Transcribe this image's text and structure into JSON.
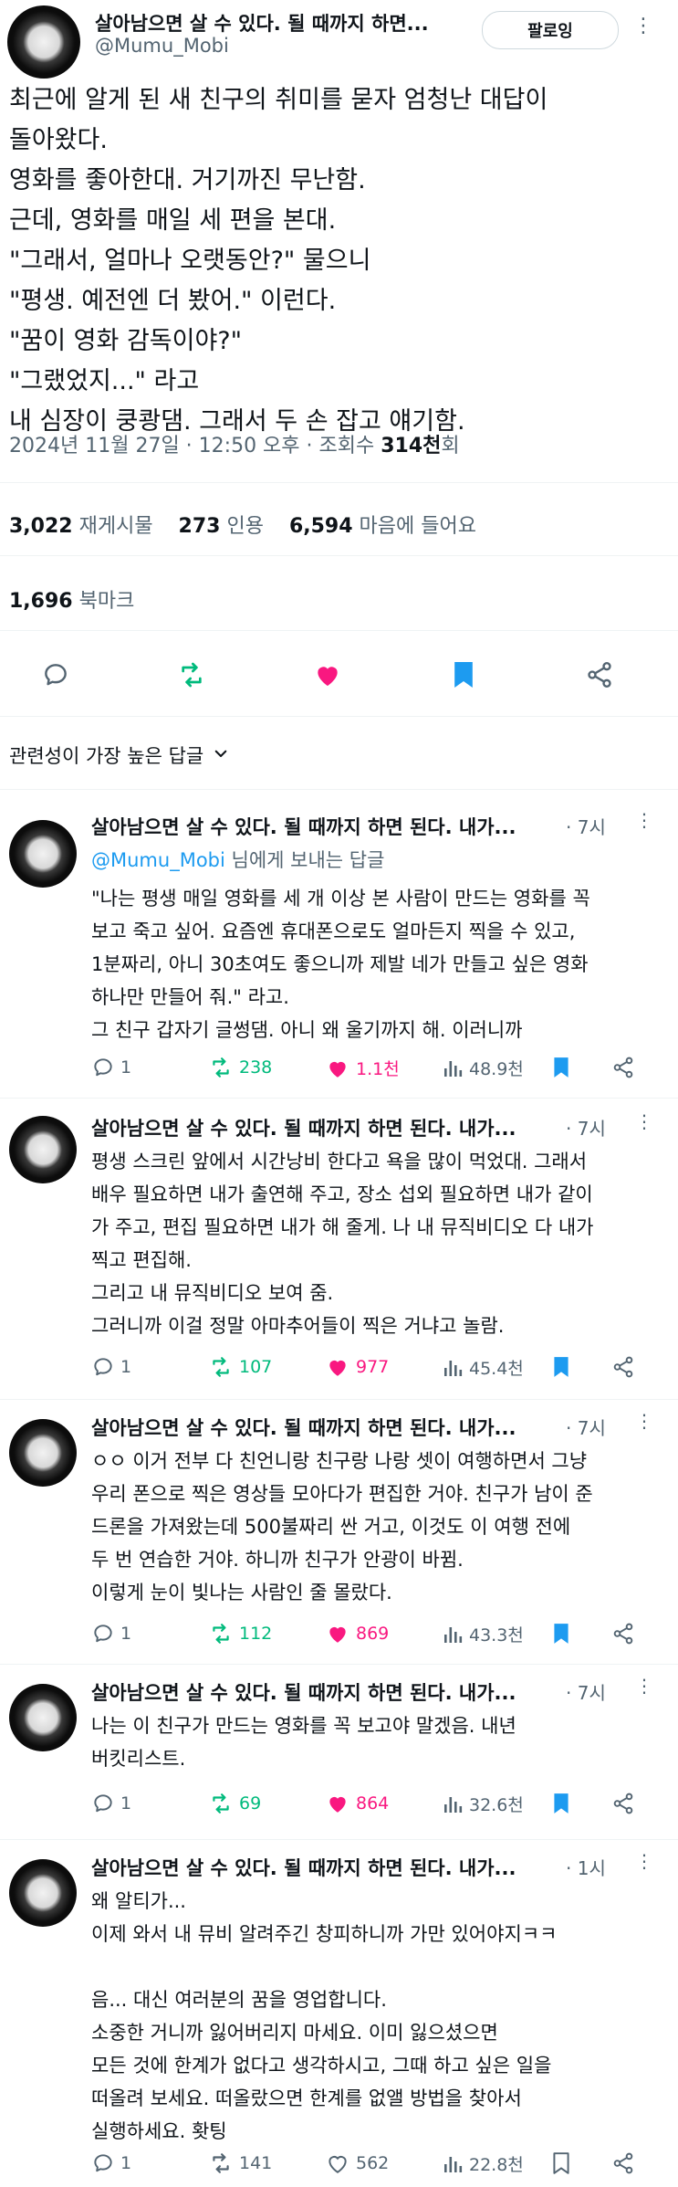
{
  "tweet": {
    "author_name": "살아남으면 살 수 있다. 될 때까지 하면...",
    "handle": "@Mumu_Mobi",
    "follow_label": "팔로잉",
    "lines": [
      "최근에 알게 된 새 친구의 취미를 묻자 엄청난 대답이",
      "돌아왔다.",
      "영화를 좋아한대. 거기까진 무난함.",
      "근데, 영화를 매일 세 편을 본대.",
      "\"그래서, 얼마나 오랫동안?\" 물으니",
      "\"평생. 예전엔 더 봤어.\" 이런다.",
      "\"꿈이 영화 감독이야?\"",
      "\"그랬었지...\" 라고",
      "내 심장이 쿵쾅댐. 그래서 두 손 잡고 얘기함."
    ],
    "date": "2024년 11월 27일 · 12:50 오후 · 조회수 ",
    "views": "314천",
    "views_suffix": "회",
    "retweets": "3,022",
    "retweets_label": "재게시물",
    "quotes": "273",
    "quotes_label": "인용",
    "likes": "6,594",
    "likes_label": "마음에 들어요",
    "bookmarks": "1,696",
    "bookmarks_label": "북마크"
  },
  "sort_label": "관련성이 가장 높은 답글",
  "colors": {
    "retweet": "#00ba7c",
    "like": "#f91880",
    "link": "#1d9bf0",
    "bookmark": "#1d9bf0"
  },
  "replies": [
    {
      "name": "살아남으면 살 수 있다. 될 때까지 하면 된다. 내가...",
      "time": "· 7시",
      "to_handle": "@Mumu_Mobi",
      "to_suffix": " 님에게 보내는 답글",
      "lines": [
        "\"나는 평생 매일 영화를 세 개 이상 본 사람이 만드는 영화를 꼭",
        "보고 죽고 싶어. 요즘엔 휴대폰으로도 얼마든지 찍을 수 있고,",
        "1분짜리, 아니 30초여도 좋으니까 제발 네가 만들고 싶은 영화",
        "하나만 만들어 줘.\" 라고.",
        "그 친구 갑자기 글썽댐. 아니 왜 울기까지 해. 이러니까"
      ],
      "replies": "1",
      "retweets": "238",
      "likes": "1.1천",
      "views": "48.9천",
      "liked": true,
      "bookmarked": true
    },
    {
      "name": "살아남으면 살 수 있다. 될 때까지 하면 된다. 내가...",
      "time": "· 7시",
      "lines": [
        "평생 스크린 앞에서 시간낭비 한다고 욕을 많이 먹었대. 그래서",
        "배우 필요하면 내가 출연해 주고, 장소 섭외 필요하면 내가 같이",
        "가 주고, 편집 필요하면 내가 해 줄게. 나 내 뮤직비디오 다 내가",
        "찍고 편집해.",
        "그리고 내 뮤직비디오 보여 줌.",
        "그러니까 이걸 정말 아마추어들이 찍은 거냐고 놀람."
      ],
      "replies": "1",
      "retweets": "107",
      "likes": "977",
      "views": "45.4천",
      "liked": true,
      "bookmarked": true
    },
    {
      "name": "살아남으면 살 수 있다. 될 때까지 하면 된다. 내가...",
      "time": "· 7시",
      "lines": [
        "ㅇㅇ 이거 전부 다 친언니랑 친구랑 나랑 셋이 여행하면서 그냥",
        "우리 폰으로 찍은 영상들 모아다가 편집한 거야. 친구가 남이 준",
        "드론을 가져왔는데 500불짜리 싼 거고, 이것도 이 여행 전에",
        "두 번 연습한 거야. 하니까 친구가 안광이 바뀜.",
        "이렇게 눈이 빛나는 사람인 줄 몰랐다."
      ],
      "replies": "1",
      "retweets": "112",
      "likes": "869",
      "views": "43.3천",
      "liked": true,
      "bookmarked": true
    },
    {
      "name": "살아남으면 살 수 있다. 될 때까지 하면 된다. 내가...",
      "time": "· 7시",
      "lines": [
        "나는 이 친구가 만드는 영화를 꼭 보고야 말겠음. 내년",
        "버킷리스트."
      ],
      "replies": "1",
      "retweets": "69",
      "likes": "864",
      "views": "32.6천",
      "liked": true,
      "bookmarked": true
    },
    {
      "name": "살아남으면 살 수 있다. 될 때까지 하면 된다. 내가...",
      "time": "· 1시",
      "lines": [
        "왜 알티가...",
        "이제 와서 내 뮤비 알려주긴 창피하니까 가만 있어야지ㅋㅋ",
        "",
        "음... 대신 여러분의 꿈을 영업합니다.",
        "소중한 거니까 잃어버리지 마세요. 이미 잃으셨으면",
        "모든 것에 한계가 없다고 생각하시고, 그때 하고 싶은 일을",
        "떠올려 보세요. 떠올랐으면 한계를 없앨 방법을 찾아서",
        "실행하세요. 홧팅"
      ],
      "replies": "1",
      "retweets": "141",
      "likes": "562",
      "views": "22.8천",
      "liked": false,
      "bookmarked": false
    }
  ]
}
